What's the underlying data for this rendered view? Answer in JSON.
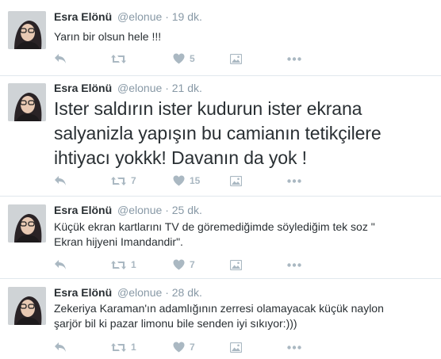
{
  "tweets": [
    {
      "name": "Esra Elönü",
      "handle": "@elonue",
      "separator": "·",
      "time": "19 dk.",
      "text": "Yarın bir olsun hele !!!",
      "size": "small",
      "retweets": "",
      "likes": "5"
    },
    {
      "name": "Esra Elönü",
      "handle": "@elonue",
      "separator": "·",
      "time": "21 dk.",
      "text_lines": [
        "Ister saldırın ister kudurun ister ekrana",
        "salyanizla yapışın  bu camianın tetikçilere",
        "ihtiyacı yokkk! Davanın da yok !"
      ],
      "size": "big",
      "retweets": "7",
      "likes": "15"
    },
    {
      "name": "Esra Elönü",
      "handle": "@elonue",
      "separator": "·",
      "time": "25 dk.",
      "text_lines": [
        "Küçük ekran kartlarını TV de göremediğimde söylediğim tek soz \"",
        "Ekran hijyeni Imandandir\"."
      ],
      "size": "small",
      "retweets": "1",
      "likes": "7"
    },
    {
      "name": "Esra Elönü",
      "handle": "@elonue",
      "separator": "·",
      "time": "28 dk.",
      "text_lines": [
        "Zekeriya Karaman'ın adamlığının zerresi olamayacak küçük naylon",
        "şarjör bil ki pazar limonu bile senden iyi sıkıyor:)))"
      ],
      "size": "small",
      "retweets": "1",
      "likes": "7"
    }
  ],
  "icons": {
    "reply": "reply-icon",
    "retweet": "retweet-icon",
    "like": "heart-icon",
    "media": "media-icon",
    "more": "more-icon"
  },
  "colors": {
    "text": "#292f33",
    "meta": "#8899a6",
    "icon": "#aab8c2",
    "divider": "#e1e8ed"
  }
}
